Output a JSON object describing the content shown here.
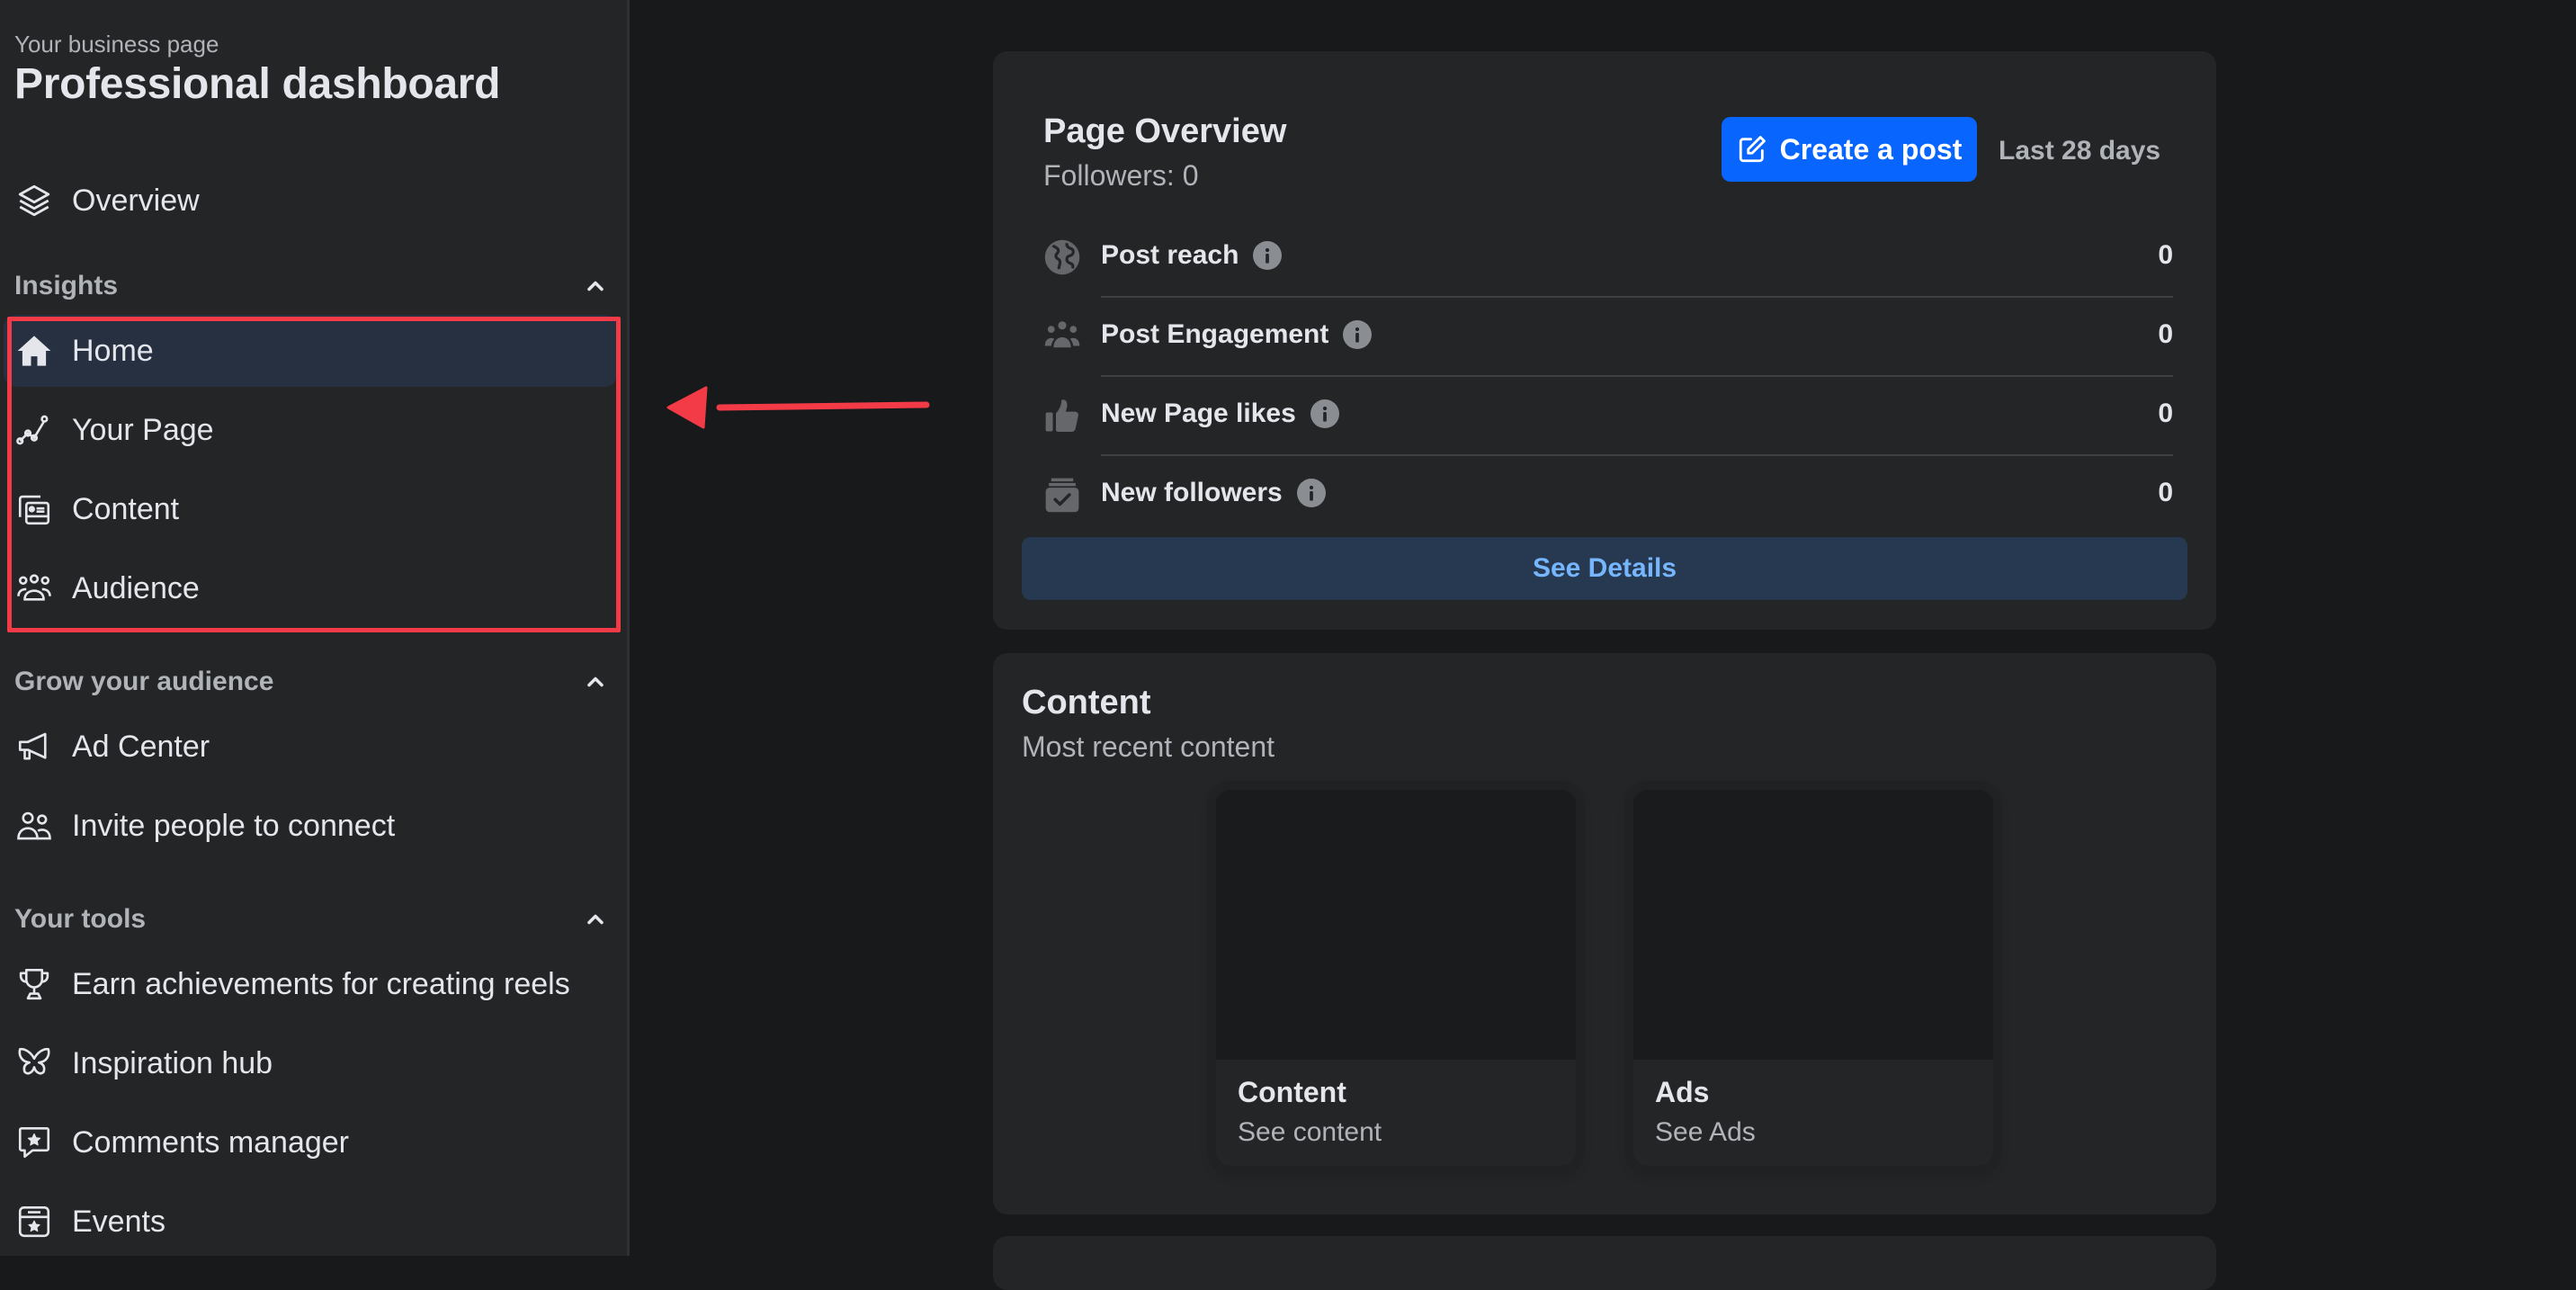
{
  "sidebar": {
    "subtitle": "Your business page",
    "title": "Professional dashboard",
    "overview": {
      "label": "Overview",
      "icon": "layers-icon"
    },
    "sections": [
      {
        "label": "Insights",
        "expanded": true,
        "items": [
          {
            "label": "Home",
            "icon": "home-icon",
            "active": true
          },
          {
            "label": "Your Page",
            "icon": "trend-line-icon"
          },
          {
            "label": "Content",
            "icon": "content-cards-icon"
          },
          {
            "label": "Audience",
            "icon": "people-group-icon"
          }
        ]
      },
      {
        "label": "Grow your audience",
        "expanded": true,
        "items": [
          {
            "label": "Ad Center",
            "icon": "megaphone-icon"
          },
          {
            "label": "Invite people to connect",
            "icon": "people-icon"
          }
        ]
      },
      {
        "label": "Your tools",
        "expanded": true,
        "items": [
          {
            "label": "Earn achievements for creating reels",
            "icon": "trophy-icon"
          },
          {
            "label": "Inspiration hub",
            "icon": "butterfly-icon"
          },
          {
            "label": "Comments manager",
            "icon": "comment-star-icon"
          },
          {
            "label": "Events",
            "icon": "calendar-star-icon"
          }
        ]
      }
    ]
  },
  "overview_card": {
    "title": "Page Overview",
    "followers": "Followers: 0",
    "create_post_label": "Create a post",
    "date_range": "Last 28 days",
    "metrics": [
      {
        "label": "Post reach",
        "value": "0",
        "icon": "globe-icon"
      },
      {
        "label": "Post Engagement",
        "value": "0",
        "icon": "engagement-people-icon"
      },
      {
        "label": "New Page likes",
        "value": "0",
        "icon": "thumbs-up-icon"
      },
      {
        "label": "New followers",
        "value": "0",
        "icon": "follower-check-icon"
      }
    ],
    "see_details_label": "See Details"
  },
  "content_card": {
    "title": "Content",
    "subtitle": "Most recent content",
    "tiles": [
      {
        "title": "Content",
        "subtitle": "See content"
      },
      {
        "title": "Ads",
        "subtitle": "See Ads"
      }
    ]
  },
  "colors": {
    "accent": "#0866ff",
    "annotation": "#f33a47",
    "active_nav_bg": "#263041",
    "link_text": "#75b6ff"
  }
}
